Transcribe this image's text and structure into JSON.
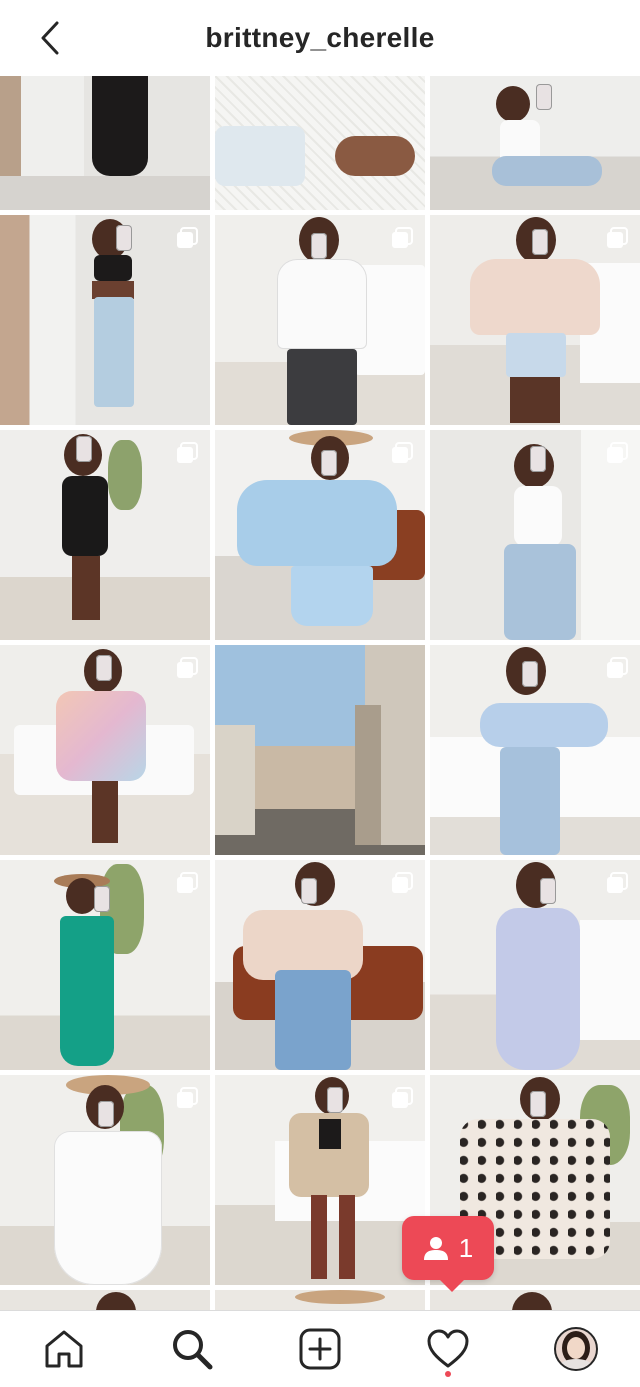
{
  "header": {
    "title": "brittney_cherelle",
    "back_icon": "chevron-left-icon"
  },
  "grid": {
    "tiles": [
      {
        "name": "post-black-skirt",
        "multi": false
      },
      {
        "name": "post-white-knit-sleeve",
        "multi": false
      },
      {
        "name": "post-white-tank-jeans-sitting",
        "multi": false
      },
      {
        "name": "post-black-crop-top-jeans",
        "multi": true
      },
      {
        "name": "post-white-peplum-top",
        "multi": true
      },
      {
        "name": "post-pink-cardigan-shorts",
        "multi": true
      },
      {
        "name": "post-black-mini-dress",
        "multi": true
      },
      {
        "name": "post-blue-romper-hat",
        "multi": true
      },
      {
        "name": "post-white-bodysuit-jeans",
        "multi": true
      },
      {
        "name": "post-floral-wrap-dress",
        "multi": true
      },
      {
        "name": "post-street-view",
        "multi": false
      },
      {
        "name": "post-blue-off-shoulder-top",
        "multi": true
      },
      {
        "name": "post-green-maxi-dress",
        "multi": true
      },
      {
        "name": "post-pink-sweater-jeans",
        "multi": true
      },
      {
        "name": "post-lavender-floral-dress",
        "multi": true
      },
      {
        "name": "post-white-sundress-hat",
        "multi": true
      },
      {
        "name": "post-blazer-boots",
        "multi": true
      },
      {
        "name": "post-leopard-romper",
        "multi": false
      }
    ]
  },
  "notification": {
    "count": "1",
    "icon": "person-icon",
    "color": "#ed4956"
  },
  "tabbar": {
    "tabs": [
      {
        "name": "home-icon"
      },
      {
        "name": "search-icon"
      },
      {
        "name": "add-post-icon"
      },
      {
        "name": "heart-icon"
      },
      {
        "name": "profile-avatar"
      }
    ],
    "activity_dot_color": "#ed4956"
  }
}
